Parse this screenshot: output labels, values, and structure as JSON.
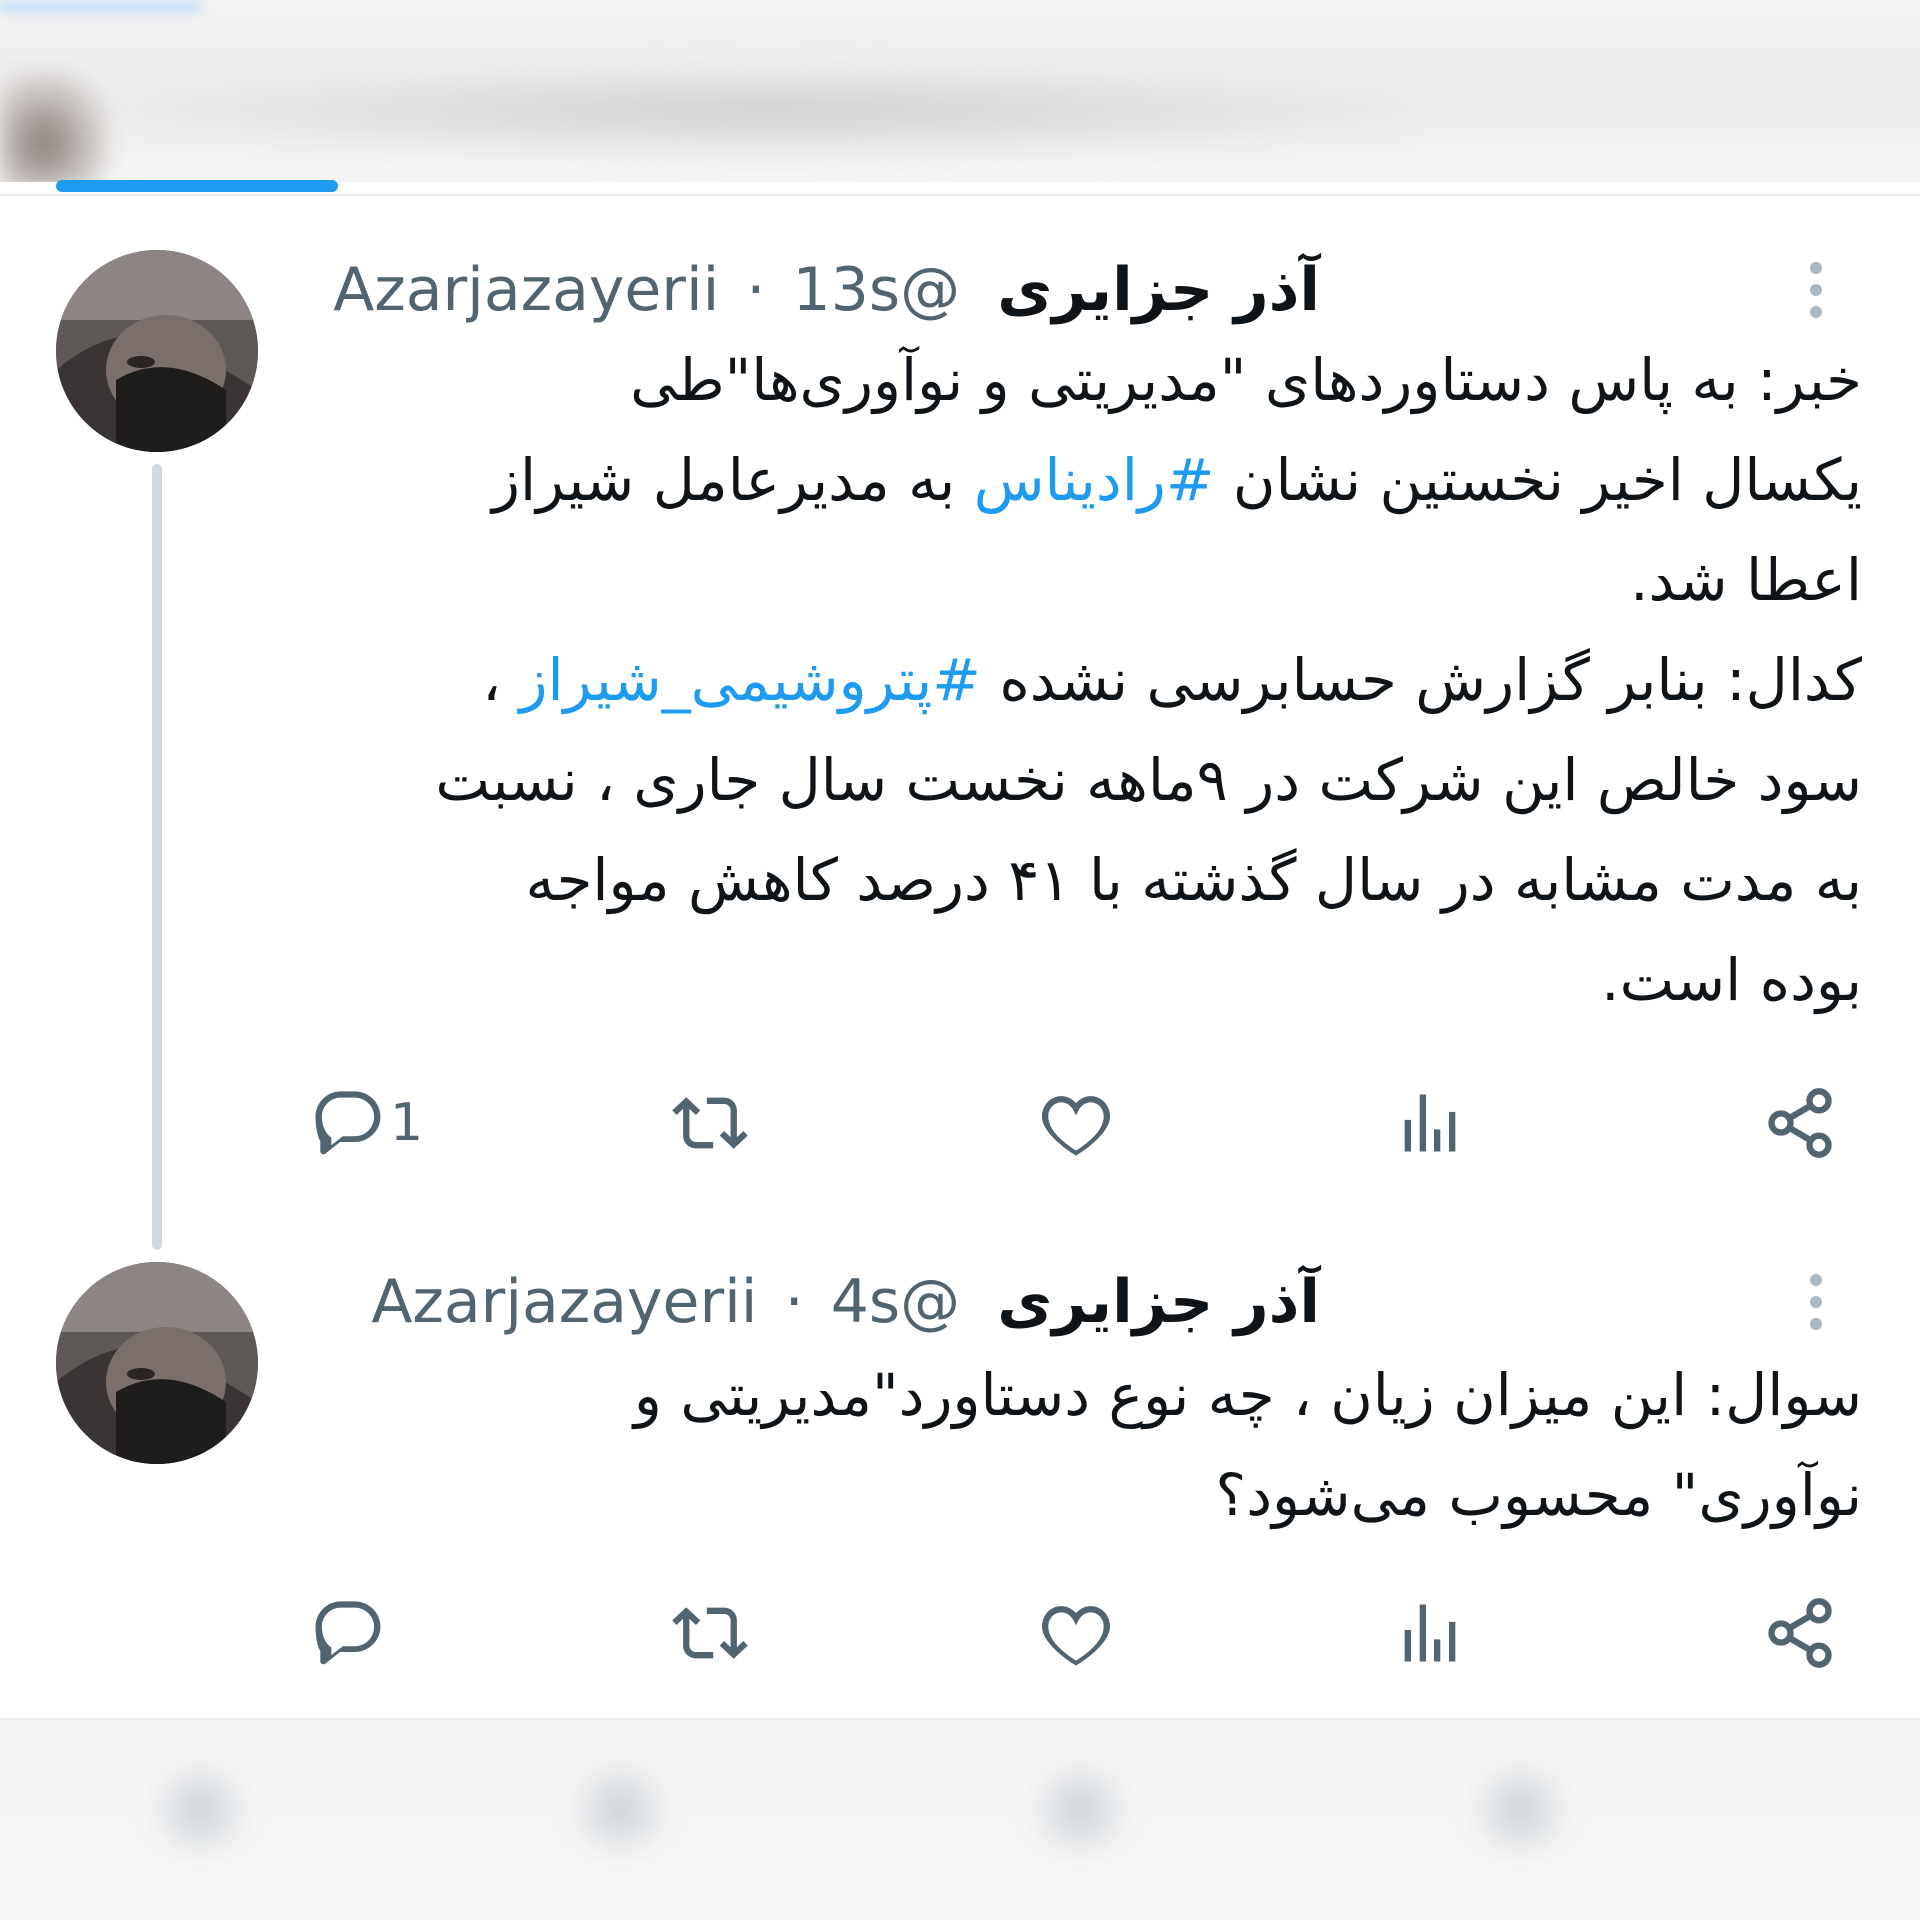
{
  "tweets": [
    {
      "display_name": "آذر جزایری",
      "handle": "@Azarjazayerii",
      "separator": "·",
      "time": "13s",
      "lines": [
        [
          {
            "t": "خبر: به پاس دستاوردهای \"مدیریتی و نوآوری‌ها\"طی"
          }
        ],
        [
          {
            "t": "یکسال اخیر نخستین نشان "
          },
          {
            "t": "#رادیناس",
            "tag": true
          },
          {
            "t": " به مدیرعامل شیراز"
          }
        ],
        [
          {
            "t": "اعطا شد."
          }
        ],
        [
          {
            "t": "کدال: بنابر گزارش حسابرسی نشده "
          },
          {
            "t": "#پتروشیمی_شیراز",
            "tag": true
          },
          {
            "t": " ،"
          }
        ],
        [
          {
            "t": "سود خالص این شرکت در ۹ماهه نخست سال جاری ،  نسبت"
          }
        ],
        [
          {
            "t": "به مدت مشابه در سال گذشته با ۴۱ درصد کاهش مواجه"
          }
        ],
        [
          {
            "t": "بوده است."
          }
        ]
      ],
      "reply_count": "1"
    },
    {
      "display_name": "آذر جزایری",
      "handle": "@Azarjazayerii",
      "separator": "·",
      "time": "4s",
      "lines": [
        [
          {
            "t": "سوال: این میزان زیان ، چه نوع دستاورد\"مدیریتی و"
          }
        ],
        [
          {
            "t": "نوآوری\" محسوب می‌شود؟"
          }
        ]
      ],
      "reply_count": ""
    }
  ],
  "icons": {
    "reply": "reply-icon",
    "retweet": "retweet-icon",
    "like": "heart-icon",
    "views": "views-icon",
    "share": "share-icon",
    "more": "more-vertical-icon"
  },
  "colors": {
    "accent": "#1d9bf0",
    "text": "#0f1419",
    "secondary": "#536471",
    "divider": "#e6ecf0"
  }
}
